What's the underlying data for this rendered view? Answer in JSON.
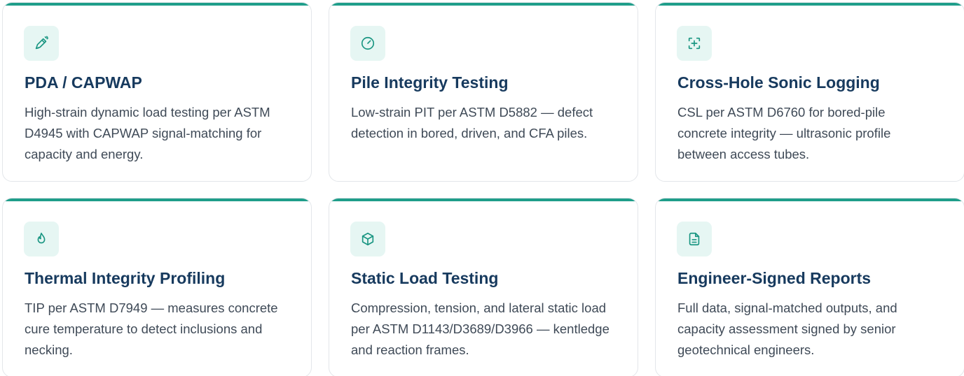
{
  "accent_color": "#1f9e8a",
  "services": [
    {
      "icon": "pen-tool-icon",
      "title": "PDA / CAPWAP",
      "description": "High-strain dynamic load testing per ASTM D4945 with CAPWAP signal-matching for capacity and energy."
    },
    {
      "icon": "gauge-icon",
      "title": "Pile Integrity Testing",
      "description": "Low-strain PIT per ASTM D5882 — defect detection in bored, driven, and CFA piles."
    },
    {
      "icon": "scan-focus-icon",
      "title": "Cross-Hole Sonic Logging",
      "description": "CSL per ASTM D6760 for bored-pile concrete integrity — ultrasonic profile between access tubes."
    },
    {
      "icon": "flame-icon",
      "title": "Thermal Integrity Profiling",
      "description": "TIP per ASTM D7949 — measures concrete cure temperature to detect inclusions and necking."
    },
    {
      "icon": "box-icon",
      "title": "Static Load Testing",
      "description": "Compression, tension, and lateral static load per ASTM D1143/D3689/D3966 — kentledge and reaction frames."
    },
    {
      "icon": "document-icon",
      "title": "Engineer-Signed Reports",
      "description": "Full data, signal-matched outputs, and capacity assessment signed by senior geotechnical engineers."
    }
  ]
}
